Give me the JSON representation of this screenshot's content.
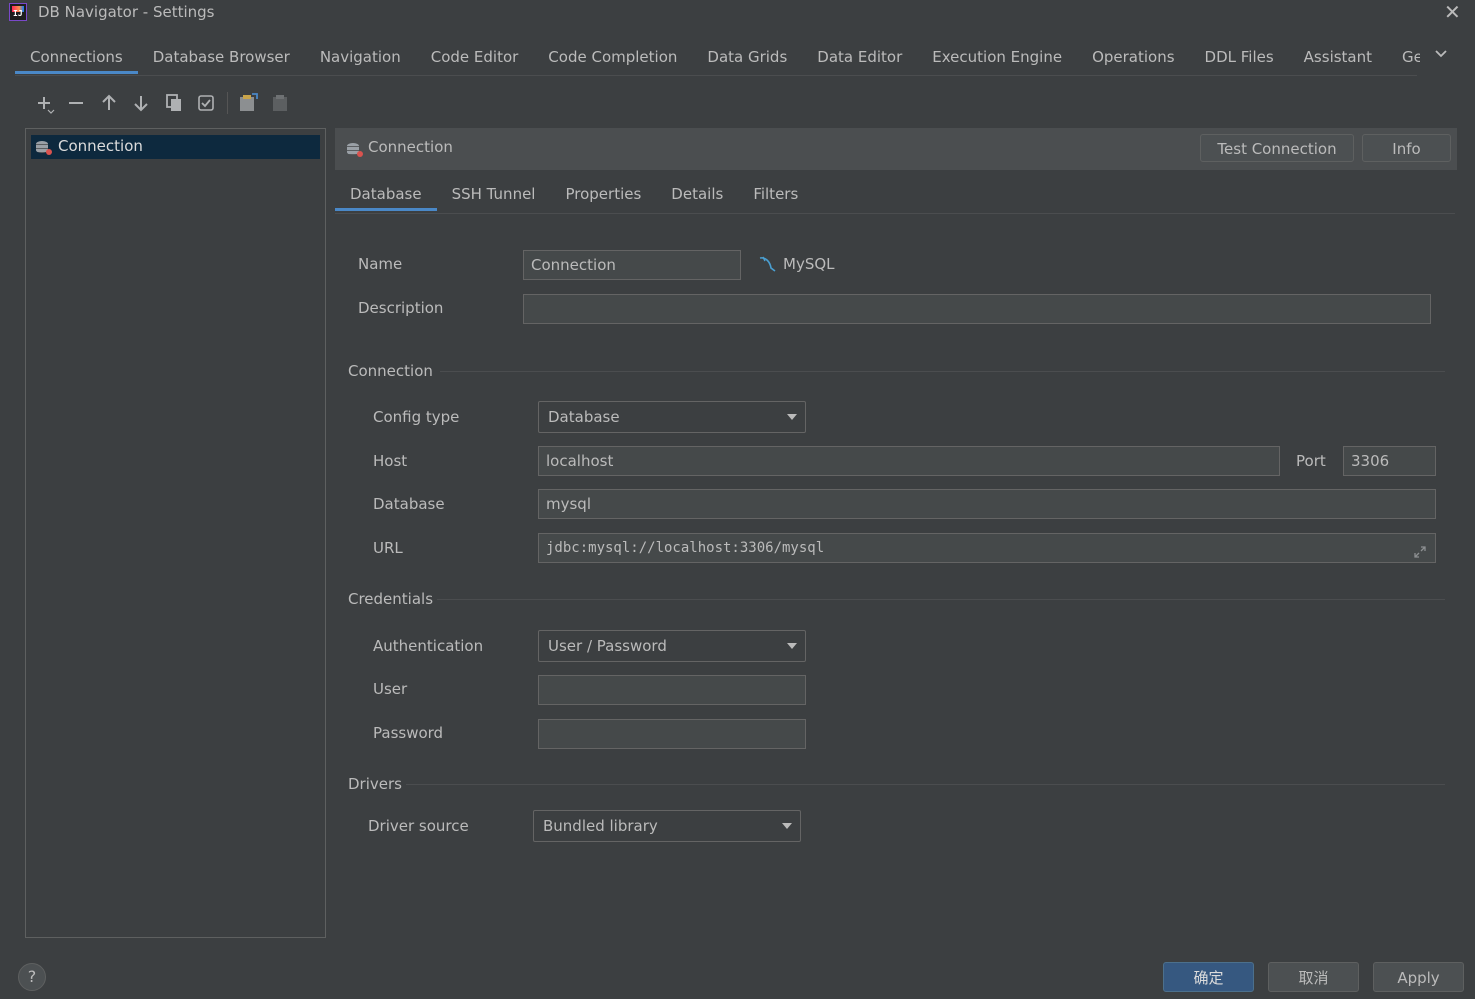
{
  "window": {
    "title": "DB Navigator - Settings",
    "app_icon_text": "IJ"
  },
  "top_tabs": [
    {
      "label": "Connections",
      "active": true
    },
    {
      "label": "Database Browser"
    },
    {
      "label": "Navigation"
    },
    {
      "label": "Code Editor"
    },
    {
      "label": "Code Completion"
    },
    {
      "label": "Data Grids"
    },
    {
      "label": "Data Editor"
    },
    {
      "label": "Execution Engine"
    },
    {
      "label": "Operations"
    },
    {
      "label": "DDL Files"
    },
    {
      "label": "Assistant"
    },
    {
      "label": "Genera"
    }
  ],
  "toolbar": {
    "icons": [
      "add-icon",
      "remove-icon",
      "move-up-icon",
      "move-down-icon",
      "copy-icon",
      "checkbox-icon",
      "import-icon",
      "paste-icon"
    ]
  },
  "connections_list": {
    "items": [
      {
        "label": "Connection",
        "selected": true
      }
    ]
  },
  "detail": {
    "header_title": "Connection",
    "test_connection_label": "Test Connection",
    "info_label": "Info",
    "tabs": [
      {
        "label": "Database",
        "active": true
      },
      {
        "label": "SSH Tunnel"
      },
      {
        "label": "Properties"
      },
      {
        "label": "Details"
      },
      {
        "label": "Filters"
      }
    ]
  },
  "form": {
    "name_label": "Name",
    "name_value": "Connection",
    "db_type": "MySQL",
    "description_label": "Description",
    "description_value": "",
    "connection_section": "Connection",
    "config_type_label": "Config type",
    "config_type_value": "Database",
    "host_label": "Host",
    "host_value": "localhost",
    "port_label": "Port",
    "port_value": "3306",
    "database_label": "Database",
    "database_value": "mysql",
    "url_label": "URL",
    "url_value": "jdbc:mysql://localhost:3306/mysql",
    "credentials_section": "Credentials",
    "authentication_label": "Authentication",
    "authentication_value": "User / Password",
    "user_label": "User",
    "user_value": "",
    "password_label": "Password",
    "password_value": "",
    "drivers_section": "Drivers",
    "driver_source_label": "Driver source",
    "driver_source_value": "Bundled library"
  },
  "footer": {
    "help": "?",
    "ok_label": "确定",
    "cancel_label": "取消",
    "apply_label": "Apply"
  },
  "colors": {
    "background": "#3c3f41",
    "accent": "#4a88c7",
    "selection": "#0d293e",
    "ok_button": "#365880"
  }
}
